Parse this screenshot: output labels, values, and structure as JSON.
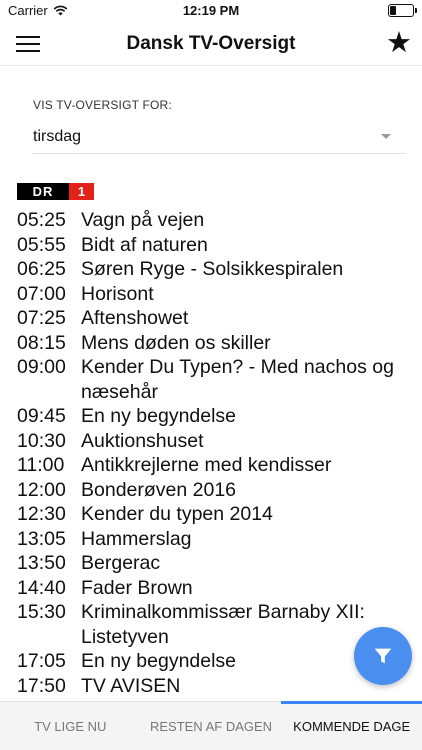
{
  "status_bar": {
    "carrier": "Carrier",
    "time": "12:19 PM",
    "battery_level": 0.25
  },
  "navbar": {
    "title": "Dansk TV-Oversigt",
    "menu_icon": "hamburger-menu-icon",
    "favorite_icon": "star-icon"
  },
  "day_selector": {
    "label": "VIS TV-OVERSIGT FOR:",
    "value": "tirsdag"
  },
  "channel": {
    "logo_part1": "DR",
    "logo_part2": "1",
    "logo_colors": {
      "primary": "#000000",
      "accent": "#e2231a"
    }
  },
  "programs": [
    {
      "time": "05:25",
      "title": "Vagn på vejen"
    },
    {
      "time": "05:55",
      "title": "Bidt af naturen"
    },
    {
      "time": "06:25",
      "title": "Søren Ryge - Solsikkespiralen"
    },
    {
      "time": "07:00",
      "title": "Horisont"
    },
    {
      "time": "07:25",
      "title": "Aftenshowet"
    },
    {
      "time": "08:15",
      "title": "Mens døden os skiller"
    },
    {
      "time": "09:00",
      "title": "Kender Du Typen? - Med nachos og næsehår"
    },
    {
      "time": "09:45",
      "title": "En ny begyndelse"
    },
    {
      "time": "10:30",
      "title": "Auktionshuset"
    },
    {
      "time": "11:00",
      "title": "Antikkrejlerne med kendisser"
    },
    {
      "time": "12:00",
      "title": "Bonderøven 2016"
    },
    {
      "time": "12:30",
      "title": "Kender du typen 2014"
    },
    {
      "time": "13:05",
      "title": "Hammerslag"
    },
    {
      "time": "13:50",
      "title": "Bergerac"
    },
    {
      "time": "14:40",
      "title": "Fader Brown"
    },
    {
      "time": "15:30",
      "title": "Kriminalkommissær Barnaby XII: Listetyven"
    },
    {
      "time": "17:05",
      "title": "En ny begyndelse"
    },
    {
      "time": "17:50",
      "title": "TV AVISEN"
    }
  ],
  "fab": {
    "icon": "filter-icon",
    "color": "#4a8ff0"
  },
  "tabs": [
    {
      "label": "TV LIGE NU",
      "active": false
    },
    {
      "label": "RESTEN AF DAGEN",
      "active": false
    },
    {
      "label": "KOMMENDE DAGE",
      "active": true
    }
  ],
  "accent_color": "#3b82f6"
}
